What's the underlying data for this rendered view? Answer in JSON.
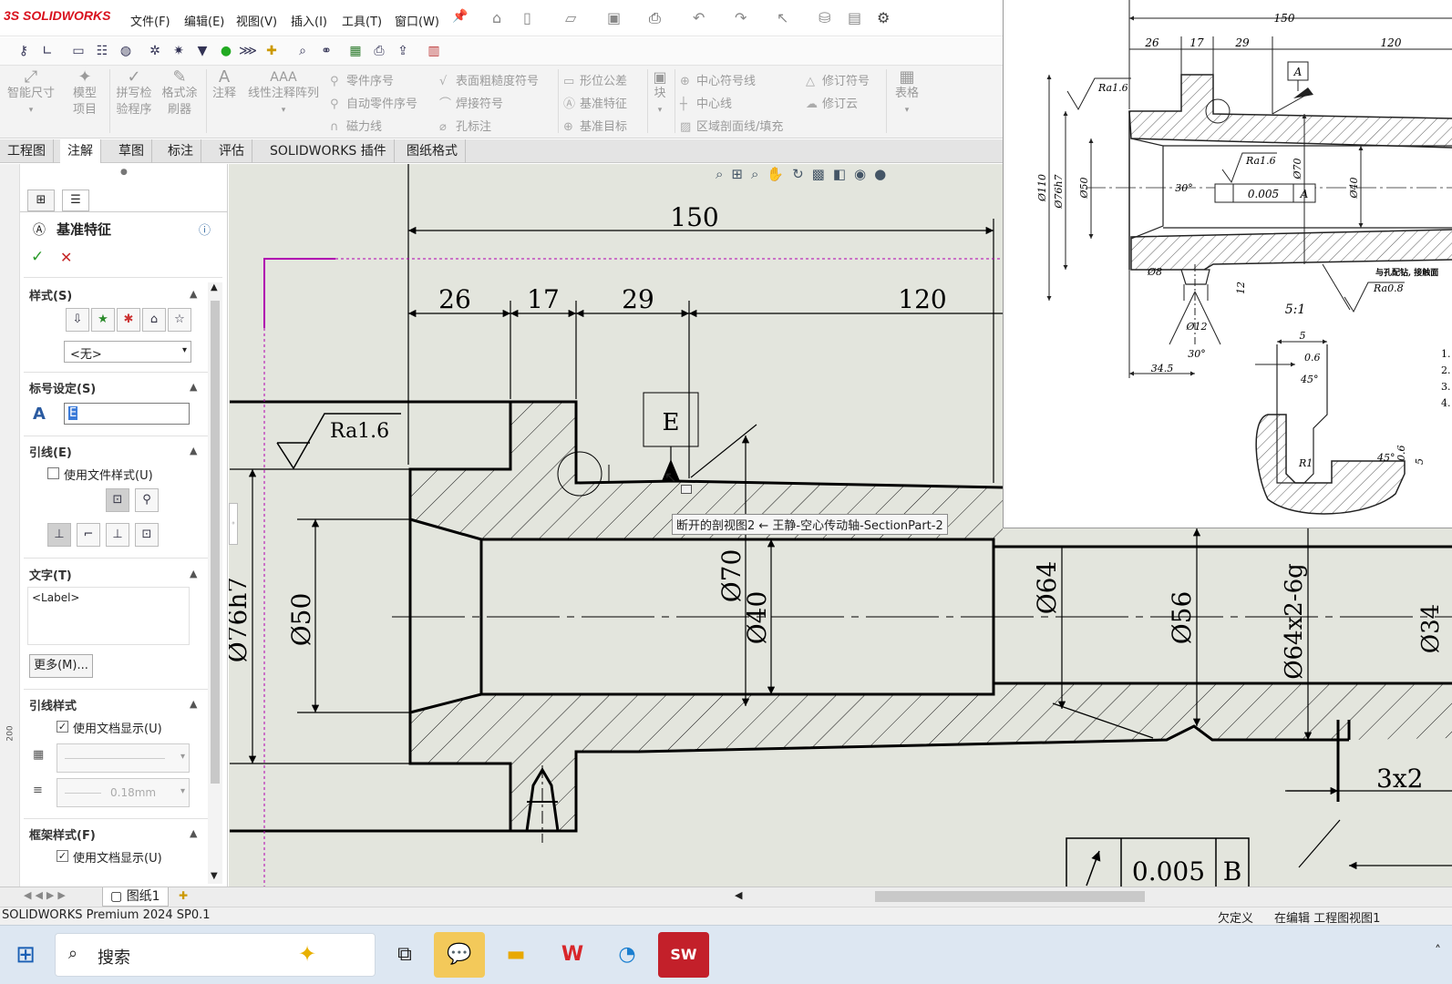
{
  "app": {
    "logo": "SOLIDWORKS",
    "logo_prefix": "3S"
  },
  "menu": [
    "文件(F)",
    "编辑(E)",
    "视图(V)",
    "插入(I)",
    "工具(T)",
    "窗口(W)"
  ],
  "ribbon": {
    "big": [
      {
        "label": "智能尺寸"
      },
      {
        "label": "模型项目"
      },
      {
        "label": "拼写检验程序"
      },
      {
        "label": "格式涂刷器"
      },
      {
        "label": "注释"
      },
      {
        "label": "线性注释阵列"
      }
    ],
    "group1": [
      "零件序号",
      "自动零件序号",
      "磁力线"
    ],
    "group2": [
      "表面粗糙度符号",
      "焊接符号",
      "孔标注"
    ],
    "group3": [
      "形位公差",
      "基准特征",
      "基准目标"
    ],
    "block": "块",
    "group4": [
      "中心符号线",
      "中心线",
      "区域剖面线/填充"
    ],
    "group5": [
      "修订符号",
      "修订云"
    ],
    "table": "表格"
  },
  "tabs": [
    "工程图",
    "注解",
    "草图",
    "标注",
    "评估",
    "SOLIDWORKS 插件",
    "图纸格式"
  ],
  "active_tab": "注解",
  "panel": {
    "title": "基准特征",
    "sections": {
      "style": "样式(S)",
      "style_select": "<无>",
      "label_settings": "标号设定(S)",
      "label_value": "E",
      "leader": "引线(E)",
      "use_file_style": "使用文件样式(U)",
      "text": "文字(T)",
      "text_value": "<Label>",
      "more_button": "更多(M)...",
      "leader_style": "引线样式",
      "use_doc_display": "使用文档显示(U)",
      "line_weight": "0.18mm",
      "frame_style": "框架样式(F)",
      "use_doc_display2": "使用文档显示(U)"
    },
    "use_file_style_checked": false,
    "use_doc_display_checked": true,
    "use_doc_display2_checked": true
  },
  "drawing": {
    "dims": {
      "d150": "150",
      "d26": "26",
      "d17": "17",
      "d29": "29",
      "d120": "120",
      "dia76": "Ø76h7",
      "dia50": "Ø50",
      "dia70": "Ø70",
      "dia40": "Ø40",
      "dia64": "Ø64",
      "dia56": "Ø56",
      "thread": "Ø64x2-6g",
      "chamfer": "3x2",
      "dia_edge": "Ø34"
    },
    "roughness": "Ra1.6",
    "datum_label": "E",
    "tolerance": "0.005",
    "tolerance_datum": "B",
    "tooltip": "断开的剖视图2 ← 王静-空心传动轴-SectionPart-2",
    "ruler_mark": "200"
  },
  "reference": {
    "d150": "150",
    "d26": "26",
    "d17": "17",
    "d29": "29",
    "d120": "120",
    "ra16a": "Ra1.6",
    "ra16b": "Ra1.6",
    "ra08": "Ra0.8",
    "datumA": "A",
    "tol": "0.005",
    "tolA": "A",
    "d110": "Ø110",
    "d76h7": "Ø76h7",
    "d50": "Ø50",
    "d70": "Ø70",
    "d40": "Ø40",
    "a30": "30°",
    "d8": "Ø8",
    "d12": "Ø12",
    "a30b": "30°",
    "d12dim": "12",
    "d345": "34.5",
    "scale": "5:1",
    "d5": "5",
    "d06": "0.6",
    "a45": "45°",
    "r1": "R1",
    "a45b": "45°",
    "d06b": "0.6",
    "d5b": "5",
    "note": "与孔配钻, 接触面",
    "edge_nums": [
      "1.",
      "2.",
      "3.",
      "4."
    ]
  },
  "sheet_tab": "图纸1",
  "status": {
    "left": "SOLIDWORKS Premium 2024 SP0.1",
    "mid": "欠定义",
    "right": "在编辑 工程图视图1"
  },
  "taskbar": {
    "search": "搜索"
  }
}
